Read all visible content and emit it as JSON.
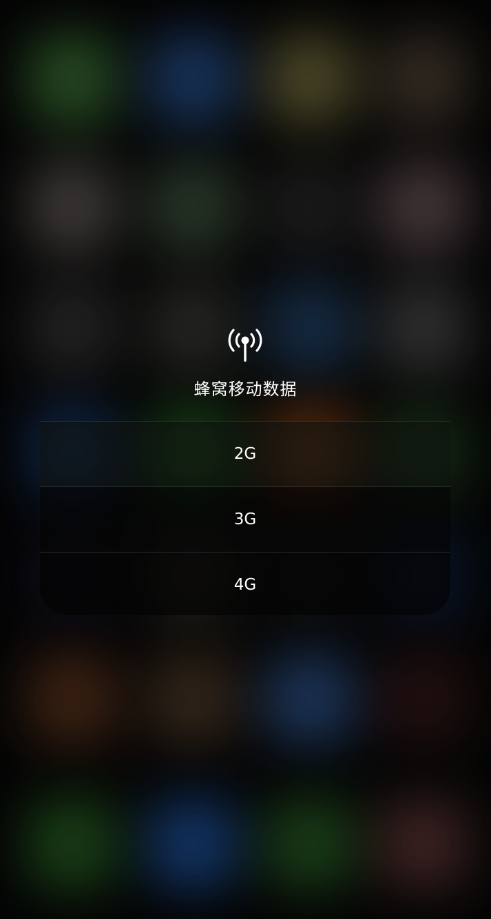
{
  "menu": {
    "title": "蜂窝移动数据",
    "icon": "cellular-antenna-icon",
    "items": [
      {
        "label": "2G"
      },
      {
        "label": "3G"
      },
      {
        "label": "4G"
      }
    ]
  },
  "colors": {
    "text": "#ffffff",
    "overlay": "#000000"
  }
}
